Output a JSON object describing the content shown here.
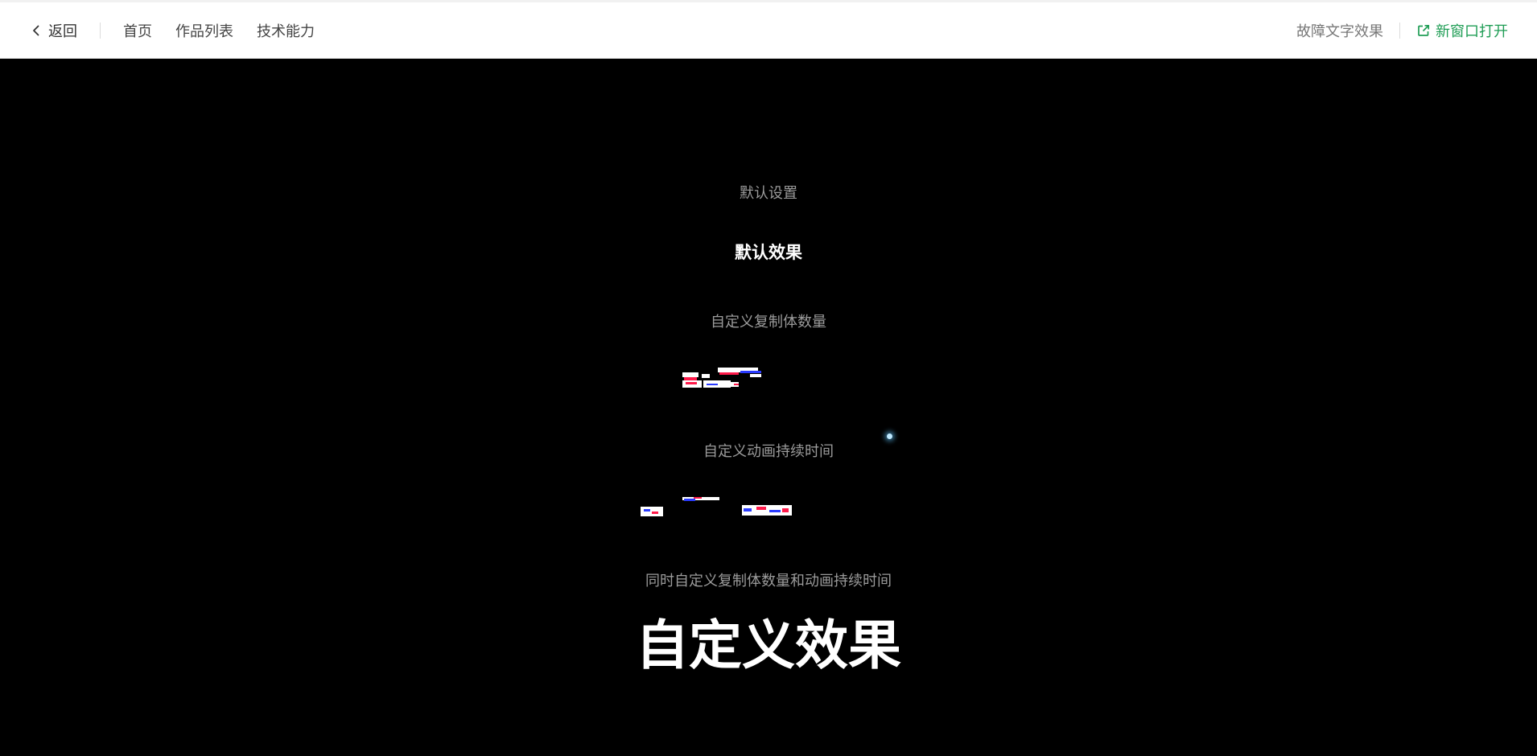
{
  "navbar": {
    "back_label": "返回",
    "links": [
      "首页",
      "作品列表",
      "技术能力"
    ],
    "current_title": "故障文字效果",
    "open_new_label": "新窗口打开",
    "accent_color": "#1f9d55"
  },
  "stage": {
    "sections": [
      {
        "title": "默认设置",
        "effect_text": "默认效果"
      },
      {
        "title": "自定义复制体数量",
        "effect_text": ""
      },
      {
        "title": "自定义动画持续时间",
        "effect_text": ""
      },
      {
        "title": "同时自定义复制体数量和动画持续时间",
        "effect_text": "自定义效果"
      }
    ],
    "glitch_colors": [
      "#ffffff",
      "#ff1a4a",
      "#2a3bff"
    ]
  },
  "icons": {
    "back": "chevron-left-icon",
    "open_new": "external-link-icon"
  }
}
